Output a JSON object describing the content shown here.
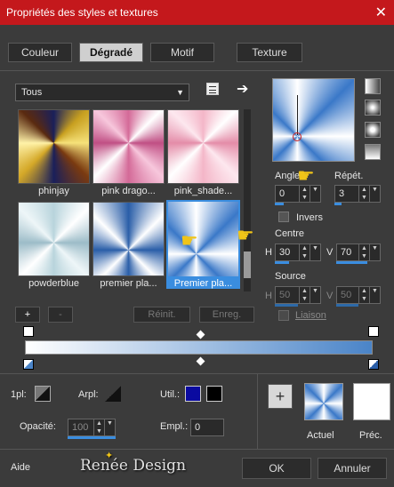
{
  "window": {
    "title": "Propriétés des styles et textures",
    "close": "✕"
  },
  "tabs": [
    {
      "label": "Couleur"
    },
    {
      "label": "Dégradé"
    },
    {
      "label": "Motif"
    },
    {
      "label": "Texture"
    }
  ],
  "category": {
    "value": "Tous"
  },
  "gradients": [
    {
      "label": "phinjay"
    },
    {
      "label": "pink drago..."
    },
    {
      "label": "pink_shade..."
    },
    {
      "label": "powderblue"
    },
    {
      "label": "premier pla..."
    },
    {
      "label": "Premier pla..."
    }
  ],
  "actions": {
    "add": "+",
    "remove": "-",
    "reset": "Réinit.",
    "save": "Enreg."
  },
  "settings": {
    "angle_label": "Angle",
    "angle": "0",
    "repeat_label": "Répét.",
    "repeat": "3",
    "invert_label": "Invers",
    "center_label": "Centre",
    "h_label": "H",
    "center_h": "30",
    "v_label": "V",
    "center_v": "70",
    "source_label": "Source",
    "source_h": "50",
    "source_v": "50",
    "link_label": "Liaison"
  },
  "bottom": {
    "ipl_label": "1pl:",
    "arpl_label": "Arpl:",
    "util_label": "Util.:",
    "opacity_label": "Opacité:",
    "opacity": "100",
    "empl_label": "Empl.:",
    "empl": "0",
    "current_label": "Actuel",
    "prev_label": "Préc."
  },
  "footer": {
    "help": "Aide",
    "watermark": "Renée Design",
    "ok": "OK",
    "cancel": "Annuler"
  },
  "colors": {
    "accent": "#3a8ddf",
    "title_bar": "#c4181c",
    "util_swatch": "#0a0aa0",
    "util_swatch2": "#000000"
  }
}
